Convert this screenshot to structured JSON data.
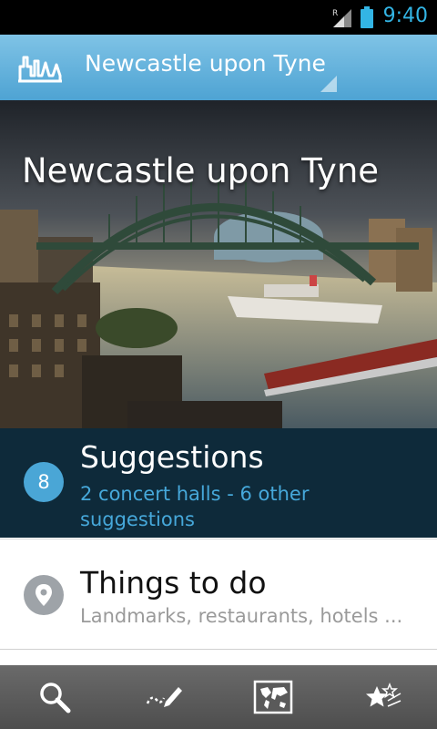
{
  "status": {
    "time": "9:40",
    "roaming_label": "R",
    "accent_color": "#33b5e5",
    "icons": [
      "signal-icon",
      "battery-icon"
    ]
  },
  "action_bar": {
    "logo_icon": "city-skyline-icon",
    "city": "Newcastle upon Tyne"
  },
  "hero": {
    "title": "Newcastle upon Tyne"
  },
  "suggestions": {
    "count": "8",
    "title": "Suggestions",
    "subtitle": "2 concert halls - 6 other suggestions"
  },
  "things_to_do": {
    "icon": "map-pin-icon",
    "title": "Things to do",
    "subtitle": "Landmarks, restaurants, hotels ..."
  },
  "bottom_nav": {
    "items": [
      "search-icon",
      "journal-pen-icon",
      "world-map-icon",
      "favorites-stars-icon"
    ]
  }
}
